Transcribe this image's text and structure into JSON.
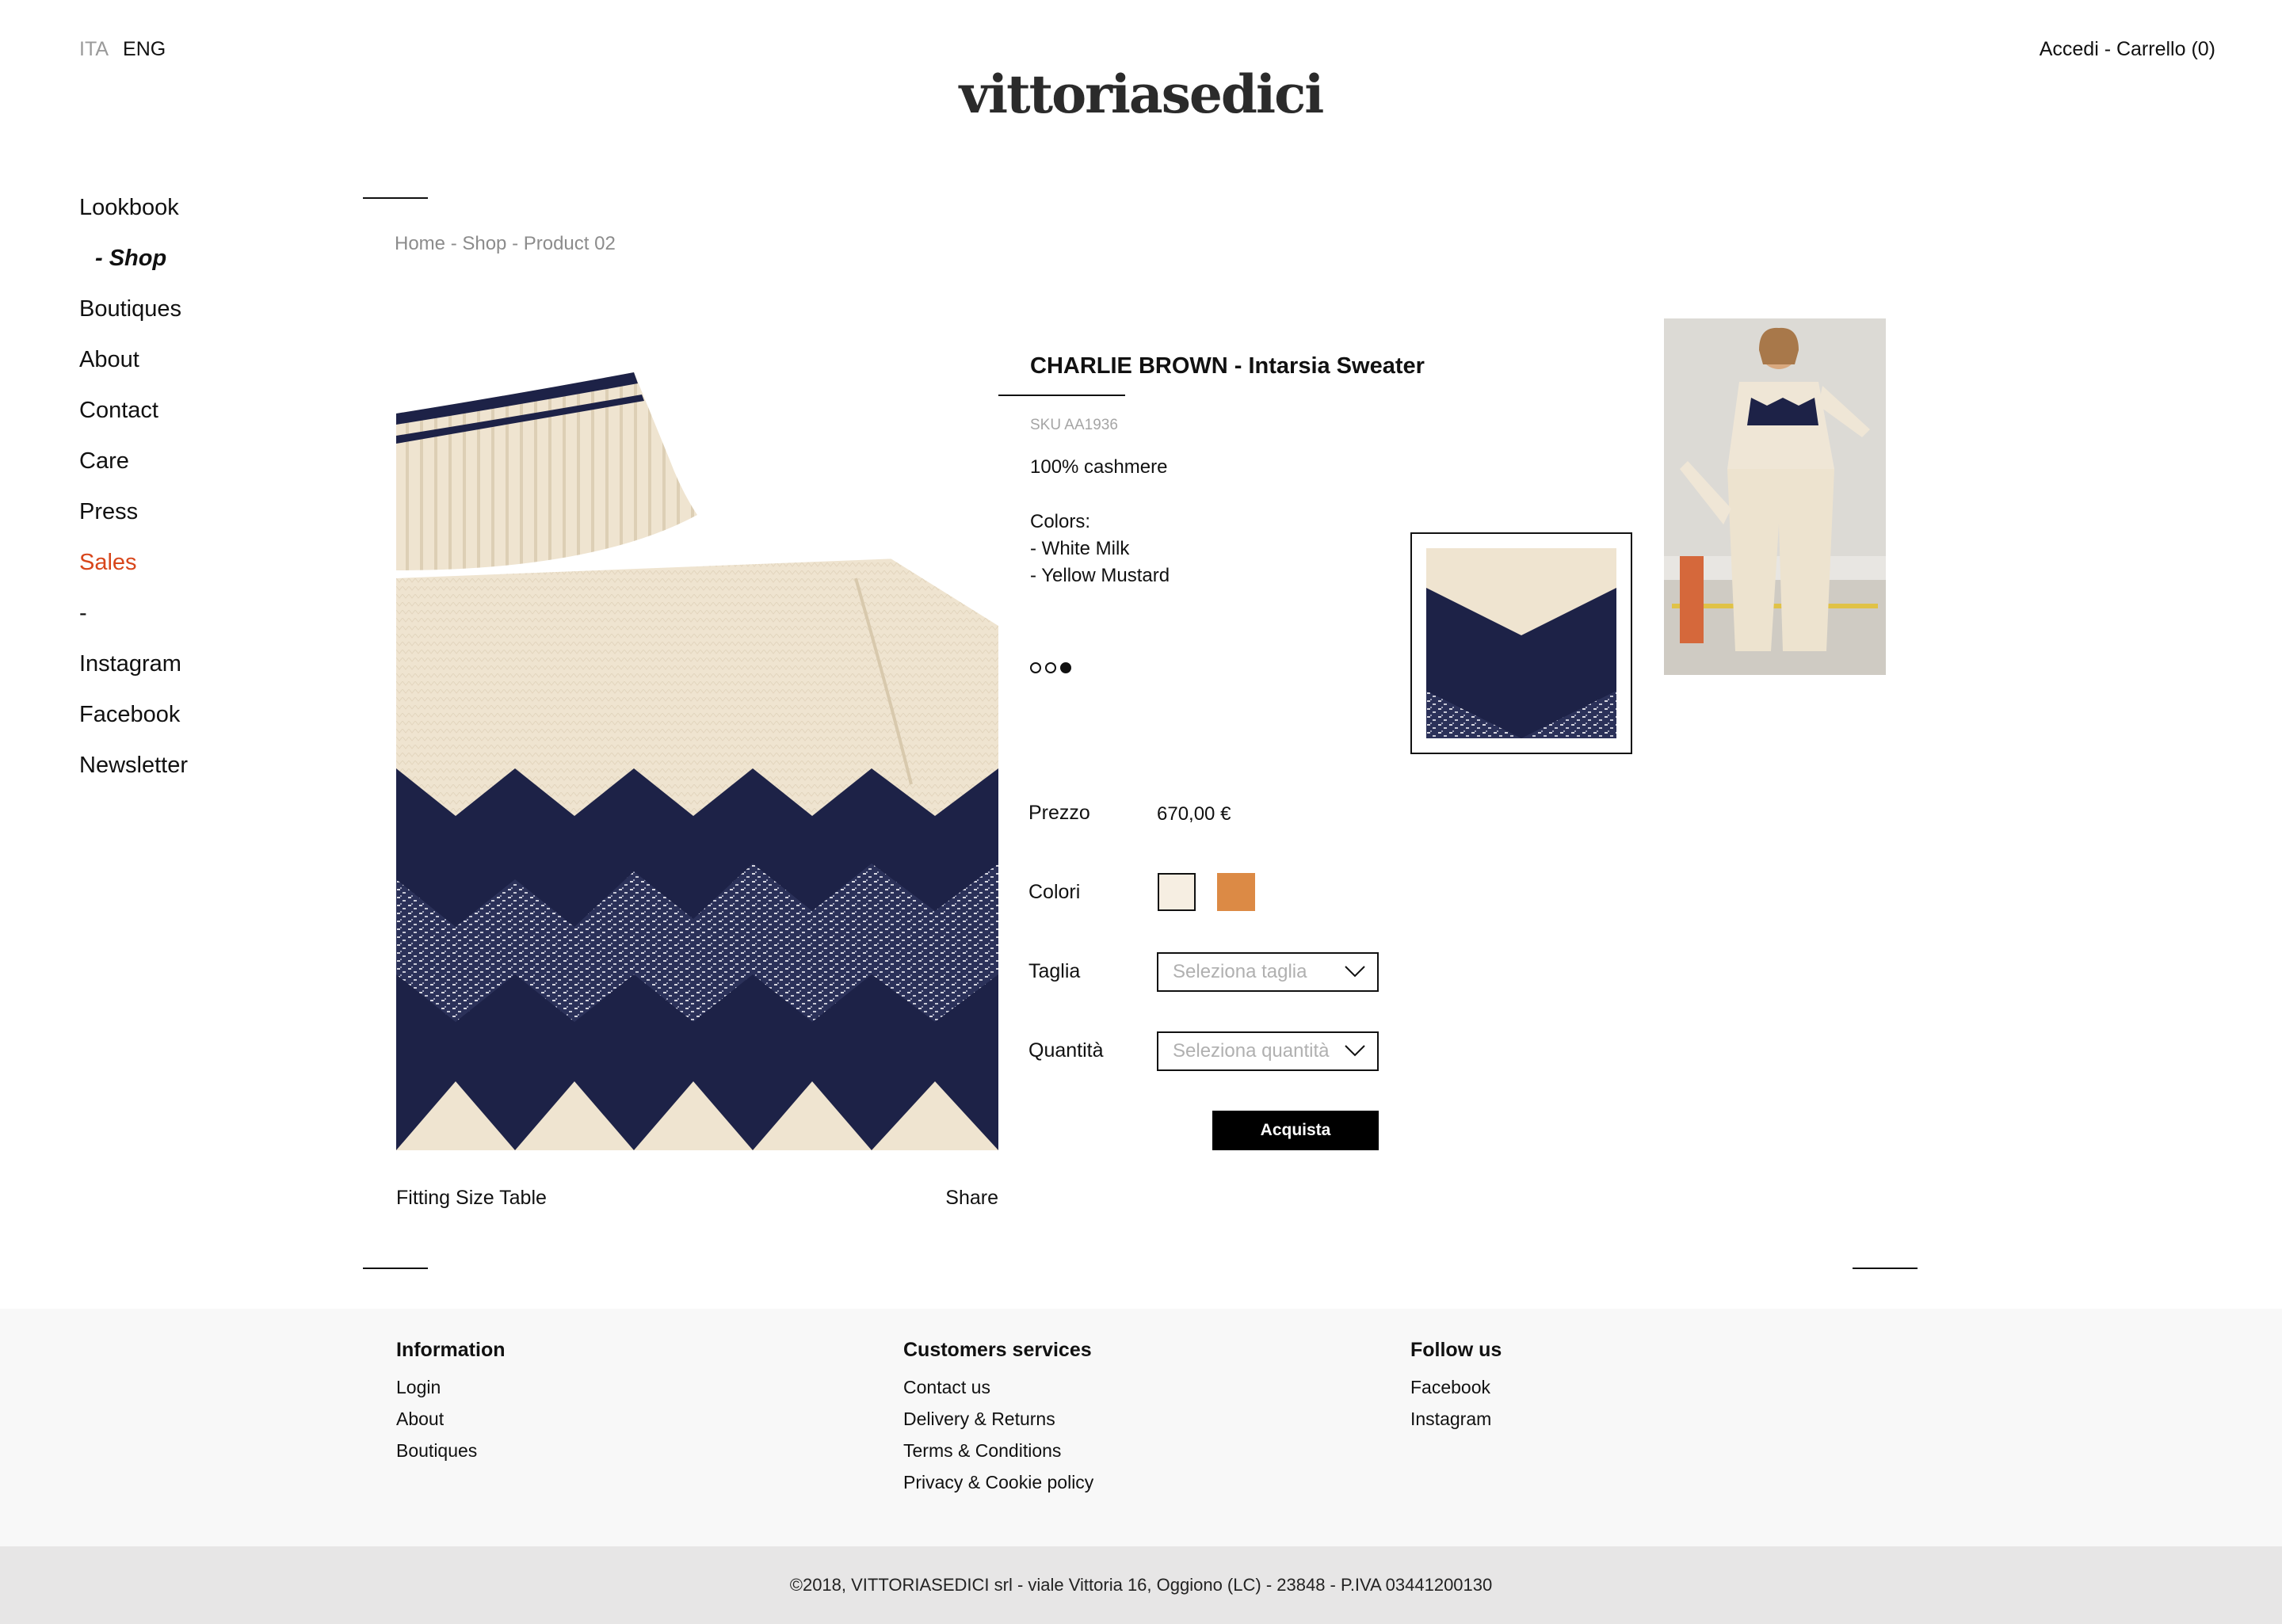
{
  "header": {
    "lang_ita": "ITA",
    "lang_eng": "ENG",
    "account": "Accedi - Carrello (0)",
    "logo": "vittoriasedici"
  },
  "nav": {
    "items": [
      "Lookbook",
      "- Shop",
      "Boutiques",
      "About",
      "Contact",
      "Care",
      "Press",
      "Sales",
      "-",
      "Instagram",
      "Facebook",
      "Newsletter"
    ]
  },
  "breadcrumb": "Home - Shop - Product 02",
  "product": {
    "title": "CHARLIE BROWN - Intarsia Sweater",
    "sku": "SKU AA1936",
    "material": "100% cashmere",
    "colors_heading": "Colors:",
    "color_list": [
      "- White Milk",
      "- Yellow Mustard"
    ],
    "price_label": "Prezzo",
    "price": "670,00 €",
    "colors_label": "Colori",
    "size_label": "Taglia",
    "size_placeholder": "Seleziona taglia",
    "qty_label": "Quantità",
    "qty_placeholder": "Seleziona quantità",
    "buy_label": "Acquista",
    "fitting_link": "Fitting Size Table",
    "share_link": "Share",
    "swatch_colors": [
      "#f6eee2",
      "#dc8a45"
    ],
    "carousel_active": 3,
    "carousel_count": 3
  },
  "footer": {
    "info_title": "Information",
    "info_links": [
      "Login",
      "About",
      "Boutiques"
    ],
    "services_title": "Customers services",
    "services_links": [
      "Contact us",
      "Delivery & Returns",
      "Terms & Conditions",
      "Privacy & Cookie policy"
    ],
    "follow_title": "Follow us",
    "follow_links": [
      "Facebook",
      "Instagram"
    ],
    "copyright": "©2018, VITTORIASEDICI srl - viale Vittoria 16, Oggiono (LC) - 23848 - P.IVA 03441200130"
  },
  "colors": {
    "accent_sales": "#d8461b",
    "navy": "#1d2247",
    "cream": "#efe4d0"
  }
}
